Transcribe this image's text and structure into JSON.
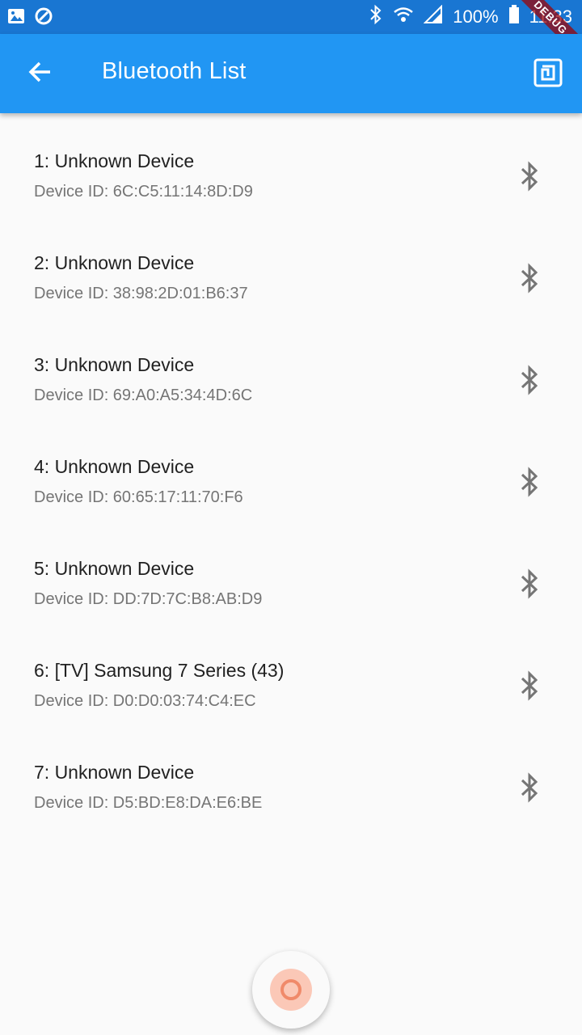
{
  "status_bar": {
    "battery": "100%",
    "time": "11:33",
    "icons": [
      "gallery-icon",
      "vpn-shield-icon",
      "bluetooth-icon",
      "wifi-icon",
      "signal-icon",
      "battery-icon"
    ]
  },
  "app_bar": {
    "title": "Bluetooth List",
    "back_icon": "arrow-back-icon",
    "action_icon": "nfc-icon",
    "background": "#2196f3"
  },
  "debug_banner": "DEBUG",
  "devices": [
    {
      "name": "1: Unknown Device",
      "device_id": "Device ID: 6C:C5:11:14:8D:D9"
    },
    {
      "name": "2: Unknown Device",
      "device_id": "Device ID: 38:98:2D:01:B6:37"
    },
    {
      "name": "3: Unknown Device",
      "device_id": "Device ID: 69:A0:A5:34:4D:6C"
    },
    {
      "name": "4: Unknown Device",
      "device_id": "Device ID: 60:65:17:11:70:F6"
    },
    {
      "name": "5: Unknown Device",
      "device_id": "Device ID: DD:7D:7C:B8:AB:D9"
    },
    {
      "name": "6: [TV] Samsung 7 Series (43)",
      "device_id": "Device ID: D0:D0:03:74:C4:EC"
    },
    {
      "name": "7: Unknown Device",
      "device_id": "Device ID: D5:BD:E8:DA:E6:BE"
    }
  ],
  "fab": {
    "icon": "scan-ring-icon",
    "accent": "#f08a6a"
  }
}
